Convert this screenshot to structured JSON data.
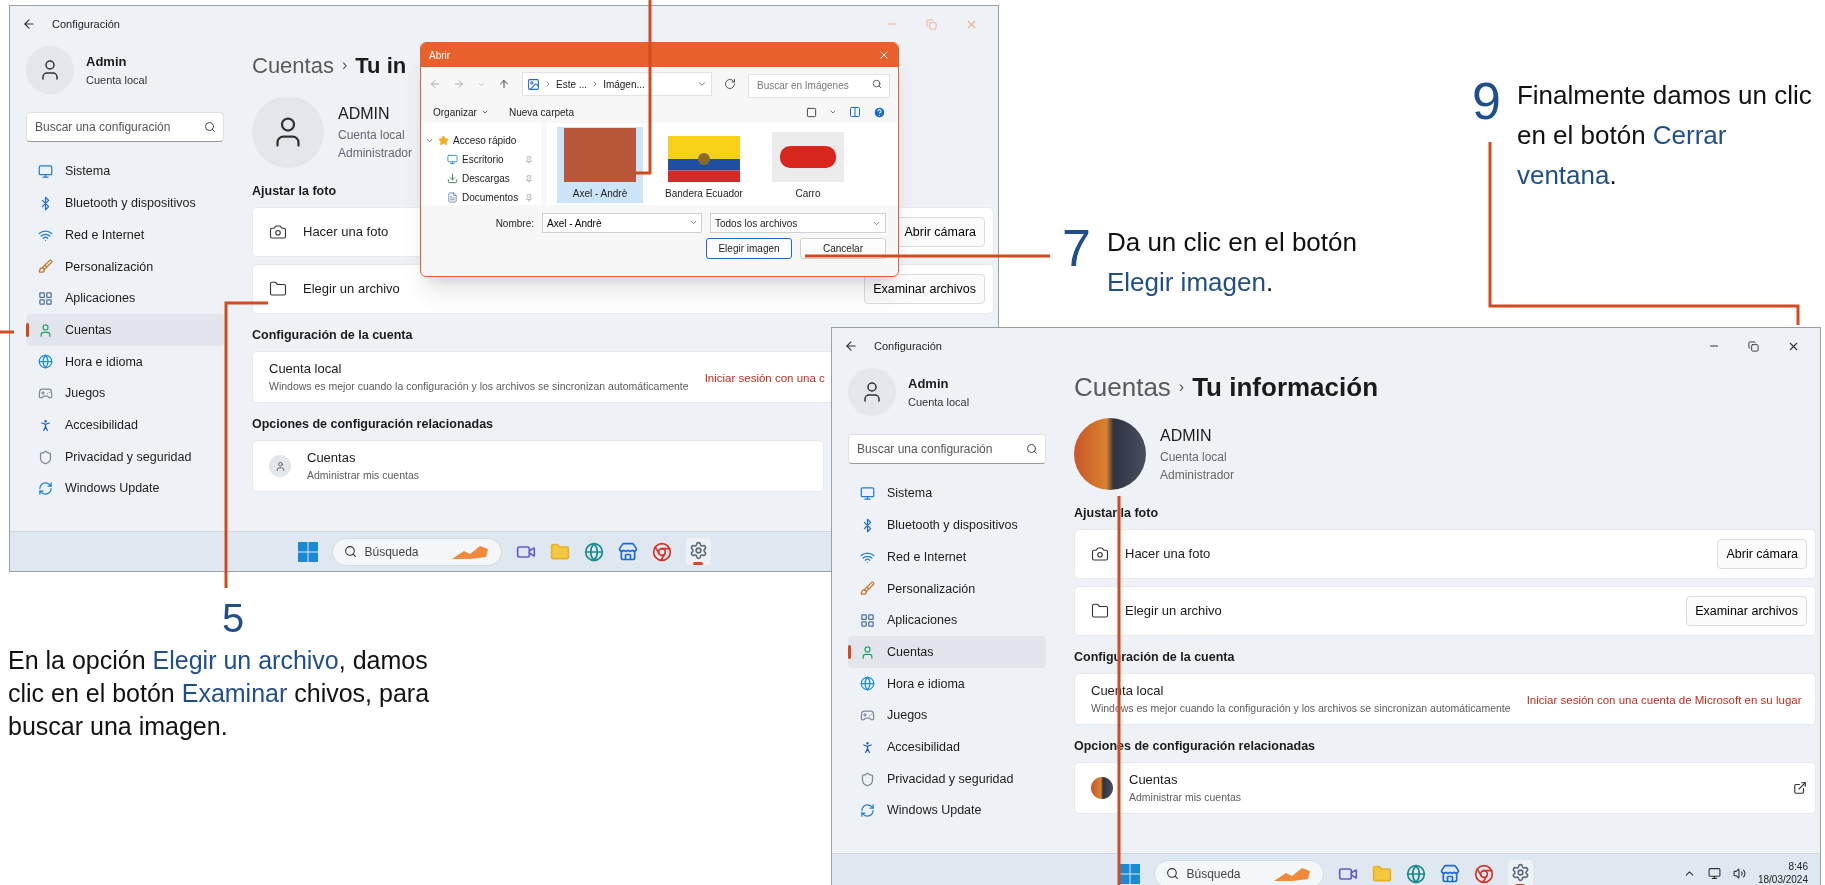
{
  "windows": [
    {
      "title": "Configuración",
      "active": false,
      "user": {
        "name": "Admin",
        "type": "Cuenta local"
      },
      "search_placeholder": "Buscar una configuración",
      "nav": [
        {
          "label": "Sistema",
          "selected": false
        },
        {
          "label": "Bluetooth y dispositivos",
          "selected": false
        },
        {
          "label": "Red e Internet",
          "selected": false
        },
        {
          "label": "Personalización",
          "selected": false
        },
        {
          "label": "Aplicaciones",
          "selected": false
        },
        {
          "label": "Cuentas",
          "selected": true
        },
        {
          "label": "Hora e idioma",
          "selected": false
        },
        {
          "label": "Juegos",
          "selected": false
        },
        {
          "label": "Accesibilidad",
          "selected": false
        },
        {
          "label": "Privacidad y seguridad",
          "selected": false
        },
        {
          "label": "Windows Update",
          "selected": false
        }
      ],
      "breadcrumb": {
        "parent": "Cuentas",
        "separator": "›",
        "current": "Tu in"
      },
      "profile": {
        "photo": false,
        "name": "ADMIN",
        "lines": [
          "Cuenta local",
          "Administrador"
        ]
      },
      "sections": [
        {
          "title": "Ajustar la foto",
          "rows": [
            {
              "kind": "action",
              "label": "Hacer una foto",
              "button": "Abrir cámara"
            },
            {
              "kind": "action",
              "label": "Elegir un archivo",
              "button": "Examinar archivos"
            }
          ]
        },
        {
          "title": "Configuración de la cuenta",
          "rows": [
            {
              "kind": "link",
              "label": "Cuenta local",
              "description": "Windows es mejor cuando la configuración y los archivos se sincronizan automáticamente",
              "link": "Iniciar sesión con una c"
            }
          ]
        },
        {
          "title": "Opciones de configuración relacionadas",
          "rows": [
            {
              "kind": "related",
              "photo": false,
              "label": "Cuentas",
              "description": "Administrar mis cuentas"
            }
          ]
        }
      ],
      "taskbar": {
        "search_placeholder": "Búsqueda"
      }
    },
    {
      "title": "Configuración",
      "active": true,
      "user": {
        "name": "Admin",
        "type": "Cuenta local"
      },
      "search_placeholder": "Buscar una configuración",
      "nav": [
        {
          "label": "Sistema",
          "selected": false
        },
        {
          "label": "Bluetooth y dispositivos",
          "selected": false
        },
        {
          "label": "Red e Internet",
          "selected": false
        },
        {
          "label": "Personalización",
          "selected": false
        },
        {
          "label": "Aplicaciones",
          "selected": false
        },
        {
          "label": "Cuentas",
          "selected": true
        },
        {
          "label": "Hora e idioma",
          "selected": false
        },
        {
          "label": "Juegos",
          "selected": false
        },
        {
          "label": "Accesibilidad",
          "selected": false
        },
        {
          "label": "Privacidad y seguridad",
          "selected": false
        },
        {
          "label": "Windows Update",
          "selected": false
        }
      ],
      "breadcrumb": {
        "parent": "Cuentas",
        "separator": "›",
        "current": "Tu información"
      },
      "profile": {
        "photo": true,
        "name": "ADMIN",
        "lines": [
          "Cuenta local",
          "Administrador"
        ]
      },
      "sections": [
        {
          "title": "Ajustar la foto",
          "rows": [
            {
              "kind": "action",
              "label": "Hacer una foto",
              "button": "Abrir cámara"
            },
            {
              "kind": "action",
              "label": "Elegir un archivo",
              "button": "Examinar archivos"
            }
          ]
        },
        {
          "title": "Configuración de la cuenta",
          "rows": [
            {
              "kind": "link",
              "label": "Cuenta local",
              "description": "Windows es mejor cuando la configuración y los archivos se sincronizan automáticamente",
              "link": "Iniciar sesión con una cuenta de Microsoft en su lugar"
            }
          ]
        },
        {
          "title": "Opciones de configuración relacionadas",
          "rows": [
            {
              "kind": "related",
              "photo": true,
              "label": "Cuentas",
              "description": "Administrar mis cuentas",
              "external_link": true
            }
          ]
        }
      ],
      "taskbar": {
        "search_placeholder": "Búsqueda",
        "time": "8:46",
        "date": "18/03/2024"
      }
    }
  ],
  "dialog": {
    "title": "Abrir",
    "path": [
      "Este ...",
      "Imágen..."
    ],
    "search_placeholder": "Buscar en Imágenes",
    "toolbar": [
      "Organizar",
      "Nueva carpeta"
    ],
    "tree": [
      {
        "label": "Acceso rápido",
        "expanded": true,
        "children": [
          {
            "label": "Escritorio"
          },
          {
            "label": "Descargas"
          },
          {
            "label": "Documentos"
          }
        ]
      }
    ],
    "files": [
      {
        "name": "Axel - Andrè",
        "kind": "photo",
        "selected": true
      },
      {
        "name": "Bandera Ecuador",
        "kind": "flag",
        "selected": false
      },
      {
        "name": "Carro",
        "kind": "car",
        "selected": false
      }
    ],
    "name_label": "Nombre:",
    "name_value": "Axel - Andrè",
    "filter": "Todos los archivos",
    "buttons": [
      {
        "label": "Elegir imagen",
        "primary": true
      },
      {
        "label": "Cancelar",
        "primary": false
      }
    ]
  },
  "callouts": [
    {
      "number": "5",
      "segments": [
        {
          "kind": "plain",
          "text": "En la opción "
        },
        {
          "kind": "highlight",
          "text": "Elegir un archivo"
        },
        {
          "kind": "plain",
          "text": ", damos clic en el botón "
        },
        {
          "kind": "highlight",
          "text": "Examinar"
        },
        {
          "kind": "plain",
          "text": " chivos, para buscar una imagen."
        }
      ]
    },
    {
      "number": "7",
      "segments": [
        {
          "kind": "plain",
          "text": "Da un clic en el botón "
        },
        {
          "kind": "highlight",
          "text": "Elegir imagen"
        },
        {
          "kind": "plain",
          "text": "."
        }
      ]
    },
    {
      "number": "9",
      "segments": [
        {
          "kind": "plain",
          "text": "Finalmente damos un clic en el botón "
        },
        {
          "kind": "highlight",
          "text": "Cerrar ventana"
        },
        {
          "kind": "plain",
          "text": "."
        }
      ]
    }
  ]
}
